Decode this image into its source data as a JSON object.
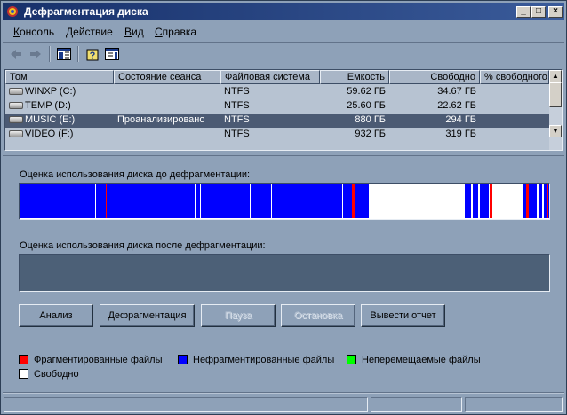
{
  "window": {
    "title": "Дефрагментация диска"
  },
  "menu": [
    {
      "label": "Консоль",
      "accel": "К",
      "rest": "онсоль"
    },
    {
      "label": "Действие",
      "accel": "Д",
      "rest": "ействие"
    },
    {
      "label": "Вид",
      "accel": "В",
      "rest": "ид"
    },
    {
      "label": "Справка",
      "accel": "С",
      "rest": "правка"
    }
  ],
  "list": {
    "columns": [
      "Том",
      "Состояние сеанса",
      "Файловая система",
      "Емкость",
      "Свободно",
      "% свободного п"
    ],
    "rows": [
      {
        "volume": "WINXP (C:)",
        "status": "",
        "fs": "NTFS",
        "capacity": "59.62 ГБ",
        "free": "34.67 ГБ",
        "pct": ""
      },
      {
        "volume": "TEMP (D:)",
        "status": "",
        "fs": "NTFS",
        "capacity": "25.60 ГБ",
        "free": "22.62 ГБ",
        "pct": ""
      },
      {
        "volume": "MUSIC (E:)",
        "status": "Проанализировано",
        "fs": "NTFS",
        "capacity": "880 ГБ",
        "free": "294 ГБ",
        "pct": ""
      },
      {
        "volume": "VIDEO (F:)",
        "status": "",
        "fs": "NTFS",
        "capacity": "932 ГБ",
        "free": "319 ГБ",
        "pct": ""
      }
    ],
    "selected_row": 2
  },
  "before_label": "Оценка использования диска до дефрагментации:",
  "after_label": "Оценка использования диска после дефрагментации:",
  "buttons": {
    "analyze": "Анализ",
    "defrag": "Дефрагментация",
    "pause": "Пауза",
    "stop": "Остановка",
    "report": "Вывести отчет"
  },
  "legend": {
    "fragmented": "Фрагментированные файлы",
    "contiguous": "Нефрагментированные файлы",
    "unmovable": "Неперемещаемые файлы",
    "free": "Свободно"
  },
  "colors": {
    "fragmented": "#ff0000",
    "contiguous": "#0000ff",
    "unmovable": "#00ff00",
    "free": "#ffffff",
    "title_bar": "#17306a",
    "selected_row": "#4b5a73"
  }
}
